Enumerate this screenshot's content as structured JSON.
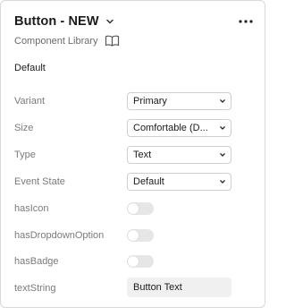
{
  "header": {
    "title": "Button - NEW",
    "library_label": "Component Library"
  },
  "section": {
    "title": "Default"
  },
  "properties": {
    "variant": {
      "label": "Variant",
      "value": "Primary"
    },
    "size": {
      "label": "Size",
      "value": "Comfortable (D..."
    },
    "type": {
      "label": "Type",
      "value": "Text"
    },
    "event_state": {
      "label": "Event State",
      "value": "Default"
    },
    "has_icon": {
      "label": "hasIcon",
      "on": false
    },
    "has_dropdown_option": {
      "label": "hasDropdownOption",
      "on": false
    },
    "has_badge": {
      "label": "hasBadge",
      "on": false
    },
    "text_string": {
      "label": "textString",
      "value": "Button Text"
    }
  },
  "icons": [
    "chevron-down-icon",
    "more-horizontal-icon",
    "open-book-icon"
  ],
  "colors": {
    "border": "#d9d9d9",
    "toggle_off": "#e6e6e6",
    "input_bg": "#f0f0f0",
    "label": "#7a7a7a"
  }
}
